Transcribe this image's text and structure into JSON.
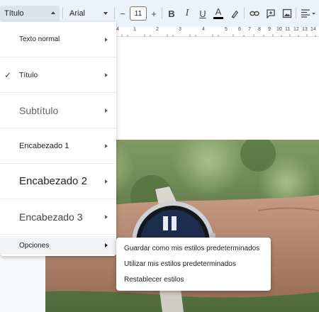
{
  "toolbar": {
    "style_value": "Título",
    "font_value": "Arial",
    "size_value": "11",
    "minus": "−",
    "plus": "+",
    "bold": "B",
    "italic": "I",
    "underline": "U",
    "text_color": "A"
  },
  "ruler": {
    "numbers": [
      "4",
      "1",
      "2",
      "3",
      "4",
      "5",
      "6",
      "7",
      "8",
      "9",
      "10",
      "11",
      "12",
      "13",
      "14"
    ]
  },
  "menu": {
    "items": [
      {
        "label": "Texto normal",
        "checked": false
      },
      {
        "label": "Título",
        "checked": true
      },
      {
        "label": "Subtítulo",
        "checked": false
      },
      {
        "label": "Encabezado 1",
        "checked": false
      },
      {
        "label": "Encabezado 2",
        "checked": false
      },
      {
        "label": "Encabezado 3",
        "checked": false
      }
    ],
    "checkmark": "✓",
    "options_label": "Opciones"
  },
  "submenu": {
    "items": [
      "Guardar como mis estilos predeterminados",
      "Utilizar mis estilos predeterminados",
      "Restablecer estilos"
    ]
  },
  "colors": {
    "toolbar_bg": "#edf2fa",
    "select_bg": "#dde3ea"
  }
}
